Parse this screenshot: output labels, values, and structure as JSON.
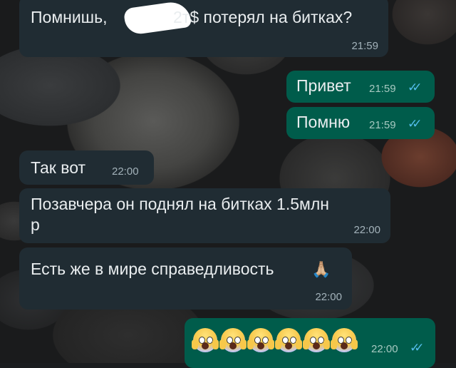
{
  "messages": [
    {
      "side": "in",
      "text_a": "Помнишь,",
      "text_b": "2т$ потерял на битках?",
      "time": "21:59"
    },
    {
      "side": "out",
      "text": "Привет",
      "time": "21:59"
    },
    {
      "side": "out",
      "text": "Помню",
      "time": "21:59"
    },
    {
      "side": "in",
      "text": "Так вот",
      "time": "22:00"
    },
    {
      "side": "in",
      "text_line1": "Позавчера он поднял на битках 1.5млн",
      "text_line2": "р",
      "time": "22:00"
    },
    {
      "side": "in",
      "text": "Есть же в мире справедливость",
      "emoji": "🙏🏼",
      "time": "22:00"
    },
    {
      "side": "out",
      "emoji_count": 6,
      "emoji_name": "face-screaming-in-fear",
      "time": "22:00"
    }
  ],
  "ticks": "✓✓",
  "colors": {
    "incoming_bubble": "#202c33",
    "outgoing_bubble": "#005c4b",
    "read_ticks": "#53bdeb",
    "text": "#e9edef"
  }
}
